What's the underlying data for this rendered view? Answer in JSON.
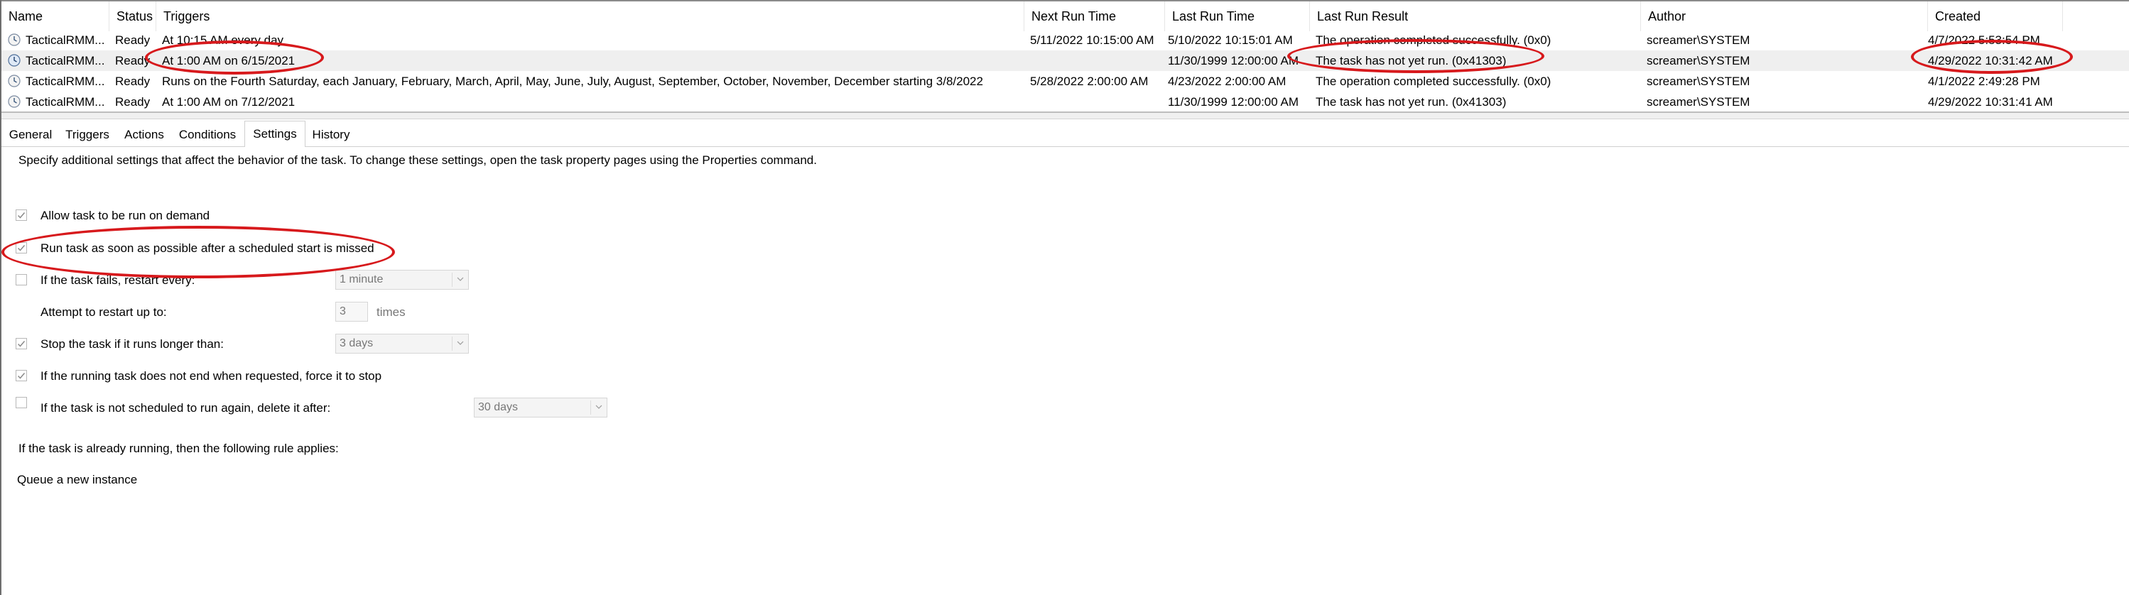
{
  "columns": {
    "name": "Name",
    "status": "Status",
    "triggers": "Triggers",
    "next_run": "Next Run Time",
    "last_run": "Last Run Time",
    "last_result": "Last Run Result",
    "author": "Author",
    "created": "Created"
  },
  "rows": [
    {
      "name": "TacticalRMM...",
      "status": "Ready",
      "triggers": "At 10:15 AM every day",
      "next_run": "5/11/2022 10:15:00 AM",
      "last_run": "5/10/2022 10:15:01 AM",
      "last_result": "The operation completed successfully. (0x0)",
      "author": "screamer\\SYSTEM",
      "created": "4/7/2022 5:53:54 PM"
    },
    {
      "name": "TacticalRMM...",
      "status": "Ready",
      "triggers": "At 1:00 AM on 6/15/2021",
      "next_run": "",
      "last_run": "11/30/1999 12:00:00 AM",
      "last_result": "The task has not yet run. (0x41303)",
      "author": "screamer\\SYSTEM",
      "created": "4/29/2022 10:31:42 AM"
    },
    {
      "name": "TacticalRMM...",
      "status": "Ready",
      "triggers": "Runs on the Fourth Saturday, each January, February, March, April, May, June, July, August, September, October, November, December starting 3/8/2022",
      "next_run": "5/28/2022 2:00:00 AM",
      "last_run": "4/23/2022 2:00:00 AM",
      "last_result": "The operation completed successfully. (0x0)",
      "author": "screamer\\SYSTEM",
      "created": "4/1/2022 2:49:28 PM"
    },
    {
      "name": "TacticalRMM...",
      "status": "Ready",
      "triggers": "At 1:00 AM on 7/12/2021",
      "next_run": "",
      "last_run": "11/30/1999 12:00:00 AM",
      "last_result": "The task has not yet run. (0x41303)",
      "author": "screamer\\SYSTEM",
      "created": "4/29/2022 10:31:41 AM"
    }
  ],
  "tabs": [
    "General",
    "Triggers",
    "Actions",
    "Conditions",
    "Settings",
    "History"
  ],
  "active_tab": "Settings",
  "settings": {
    "intro": "Specify additional settings that affect the behavior of the task. To change these settings, open the task property pages using the Properties command.",
    "allow_on_demand": "Allow task to be run on demand",
    "run_asap": "Run task as soon as possible after a scheduled start is missed",
    "restart_every": "If the task fails, restart every:",
    "restart_every_value": "1 minute",
    "attempt_restart": "Attempt to restart up to:",
    "attempt_value": "3",
    "times": "times",
    "stop_longer": "Stop the task if it runs longer than:",
    "stop_value": "3 days",
    "force_stop": "If the running task does not end when requested, force it to stop",
    "delete_after": "If the task is not scheduled to run again, delete it after:",
    "delete_value": "30 days",
    "rule_label": "If the task is already running, then the following rule applies:",
    "rule_value": "Queue a new instance"
  },
  "checkbox_states": {
    "allow_on_demand": true,
    "run_asap": true,
    "restart_every": false,
    "stop_longer": true,
    "force_stop": true,
    "delete_after": false
  },
  "colors": {
    "annotation": "#d7191c",
    "selected_row": "#efefef"
  }
}
